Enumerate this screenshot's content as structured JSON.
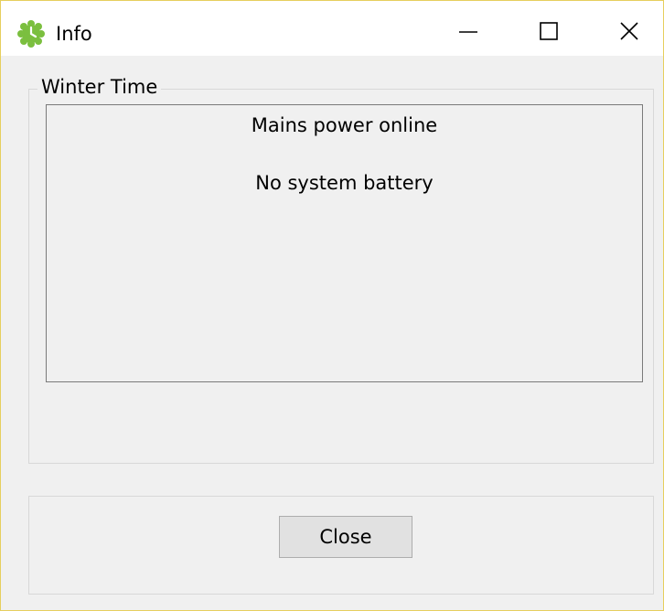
{
  "window": {
    "title": "Info",
    "icon": "green-clock-icon",
    "border_color": "#e6cf5e",
    "background_color": "#f0f0f0"
  },
  "titlebar": {
    "minimize": "minimize-icon",
    "maximize": "maximize-icon",
    "close": "close-icon"
  },
  "group": {
    "label": "Winter Time"
  },
  "info": {
    "power_status": "Mains power online",
    "battery_status": "No system battery"
  },
  "buttons": {
    "close_label": "Close"
  },
  "colors": {
    "icon_green": "#7bbf3f",
    "button_face": "#e1e1e1",
    "button_border": "#adadad"
  }
}
